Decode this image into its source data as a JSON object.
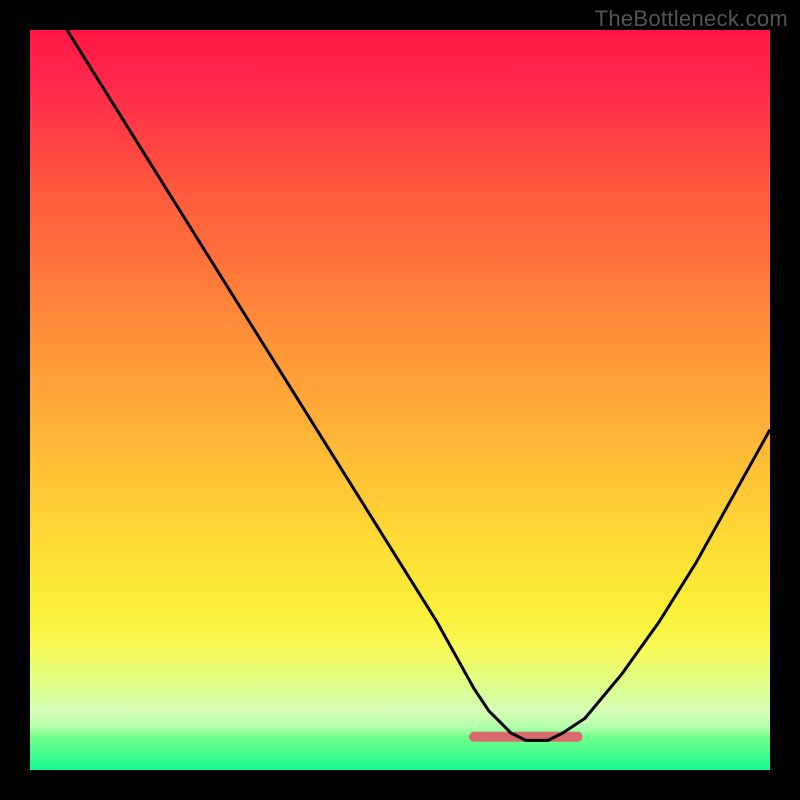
{
  "watermark": "TheBottleneck.com",
  "colors": {
    "page_bg": "#000000",
    "curve_stroke": "#000000",
    "target_stroke": "#d86b6e"
  },
  "chart_data": {
    "type": "line",
    "title": "",
    "xlabel": "",
    "ylabel": "",
    "xlim": [
      0,
      100
    ],
    "ylim": [
      0,
      100
    ],
    "grid": false,
    "legend": false,
    "note": "V-shaped bottleneck curve; y represents bottleneck percentage, minimum around x≈67. Values estimated from pixel positions on a 740×740 plot area.",
    "series": [
      {
        "name": "bottleneck_curve",
        "x": [
          5,
          10,
          15,
          20,
          25,
          30,
          35,
          40,
          45,
          50,
          55,
          60,
          62,
          65,
          67,
          70,
          72,
          75,
          80,
          85,
          90,
          95,
          100
        ],
        "y": [
          100,
          92,
          84,
          76,
          68,
          60,
          52,
          44,
          36,
          28,
          20,
          11,
          8,
          5,
          4,
          4,
          5,
          7,
          13,
          20,
          28,
          37,
          46
        ]
      }
    ],
    "target_band": {
      "name": "optimal_zone",
      "x_range": [
        60,
        74
      ],
      "y_level": 4.5
    }
  }
}
